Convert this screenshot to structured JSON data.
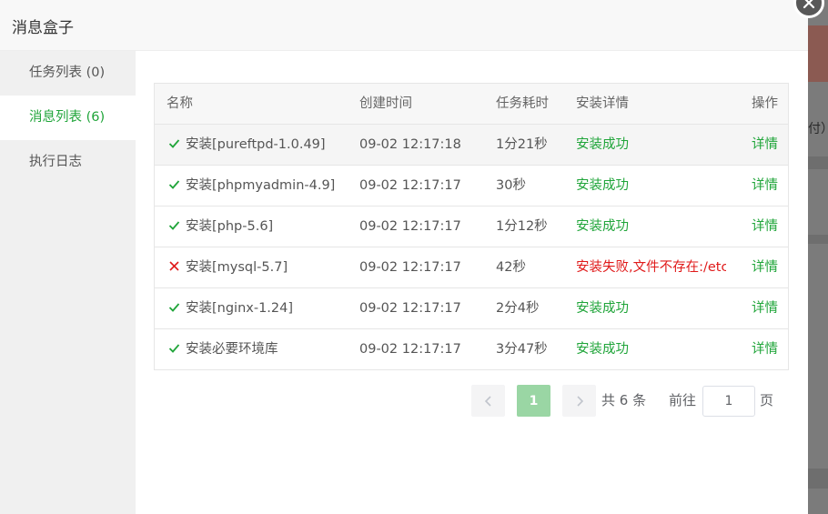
{
  "modal": {
    "title": "消息盒子"
  },
  "sidebar": {
    "items": [
      {
        "label": "任务列表 (0)"
      },
      {
        "label": "消息列表 (6)"
      },
      {
        "label": "执行日志"
      }
    ]
  },
  "background": {
    "partial_text": "付）"
  },
  "table": {
    "headers": {
      "name": "名称",
      "time": "创建时间",
      "duration": "任务耗时",
      "details": "安装详情",
      "action": "操作"
    },
    "rows": [
      {
        "status": "success",
        "name": "安装[pureftpd-1.0.49]",
        "time": "09-02 12:17:18",
        "duration": "1分21秒",
        "details": "安装成功",
        "action": "详情"
      },
      {
        "status": "success",
        "name": "安装[phpmyadmin-4.9]",
        "time": "09-02 12:17:17",
        "duration": "30秒",
        "details": "安装成功",
        "action": "详情"
      },
      {
        "status": "success",
        "name": "安装[php-5.6]",
        "time": "09-02 12:17:17",
        "duration": "1分12秒",
        "details": "安装成功",
        "action": "详情"
      },
      {
        "status": "failed",
        "name": "安装[mysql-5.7]",
        "time": "09-02 12:17:17",
        "duration": "42秒",
        "details": "安装失败,文件不存在:/etc",
        "action": "详情"
      },
      {
        "status": "success",
        "name": "安装[nginx-1.24]",
        "time": "09-02 12:17:17",
        "duration": "2分4秒",
        "details": "安装成功",
        "action": "详情"
      },
      {
        "status": "success",
        "name": "安装必要环境库",
        "time": "09-02 12:17:17",
        "duration": "3分47秒",
        "details": "安装成功",
        "action": "详情"
      }
    ]
  },
  "pagination": {
    "current_page": "1",
    "total_text": "共 6 条",
    "goto_label": "前往",
    "goto_value": "1",
    "page_suffix": "页"
  },
  "colors": {
    "accent": "#20a53a",
    "error": "#e01a1a",
    "page_active": "#9ad6a4"
  }
}
